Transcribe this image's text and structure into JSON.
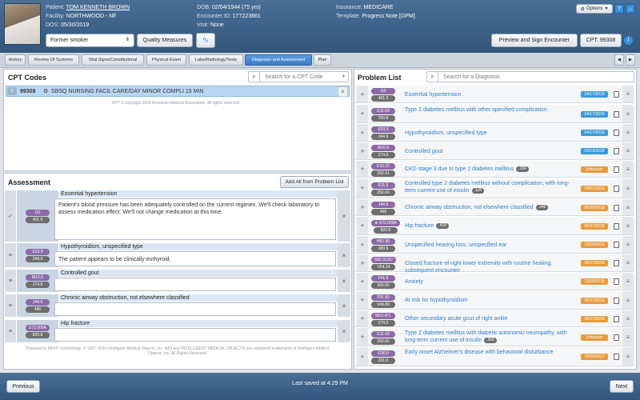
{
  "patient": {
    "label_patient": "Patient:",
    "name": "TOM KENNETH BROWN",
    "label_facility": "Facility:",
    "facility": "NORTHWOOD - NF",
    "label_dos": "DOS:",
    "dos": "05/30/2019",
    "label_dob": "DOB:",
    "dob": "02/04/1944 (75 yrs)",
    "label_encounter": "Encounter ID:",
    "encounter_id": "177223661",
    "label_visit": "Visit:",
    "visit": "None",
    "label_insurance": "Insurance:",
    "insurance": "MEDICARE",
    "label_template": "Template:",
    "template": "Progress Note [GPM]"
  },
  "header": {
    "options": "Options",
    "smoker": "Former smoker",
    "quality": "Quality Measures",
    "preview": "Preview and Sign Encounter",
    "cpt": "CPT: 99308"
  },
  "tabs": [
    "History",
    "Review Of Systems",
    "Vital Signs/Constitutional",
    "Physical Exam",
    "Labs/Radiology/Tests",
    "Diagnosis and Assessment",
    "Plan"
  ],
  "cpt": {
    "title": "CPT Codes",
    "search_placeholder": "Search for a CPT Code",
    "row_code": "99308",
    "row_desc": "SBSQ NURSING FACIL CARE/DAY MINOR COMPLI 15 MIN",
    "copyright": "CPT © copyright 2018 American Medical Association. All rights reserved."
  },
  "assessment": {
    "title": "Assessment",
    "add_all": "Add All from Problem List",
    "footer": "Powered by IMO® Terminology. © 1997–2015 Intelligent Medical Objects, Inc. IMO and INTELLIGENT MEDICAL OBJECTS are registered trademarks of Intelligent Medical Objects, Inc. All Rights Reserved.",
    "items": [
      {
        "c1": "I10",
        "c2": "401.9",
        "title": "Essential hypertension",
        "note": "Patient's blood pressure has been adequately controlled on the current regimen. We'll check laboratory to assess medication effect. We'll not change medication at this time."
      },
      {
        "c1": "E03.9",
        "c2": "244.9",
        "title": "Hypothyroidism, unspecified type",
        "note": "The patient appears to be clinically euthyroid."
      },
      {
        "c1": "M10.9",
        "c2": "274.9",
        "title": "Controlled gout",
        "note": ""
      },
      {
        "c1": "J44.9",
        "c2": "496",
        "title": "Chronic airway obstruction, not elsewhere classified",
        "note": ""
      },
      {
        "c1": "S72.009A",
        "c2": "820.8",
        "title": "Hip fracture",
        "note": ""
      }
    ]
  },
  "problems": {
    "title": "Problem List",
    "search_placeholder": "Search for a Diagnosis",
    "items": [
      {
        "c1": "I10",
        "c2": "401.9",
        "name": "Essential hypertension",
        "date": "04/17/2019",
        "pct": ""
      },
      {
        "c1": "E11.69",
        "c2": "250.8",
        "name": "Type 2 diabetes mellitus with other specified complication",
        "date": "04/17/2019",
        "pct": ""
      },
      {
        "c1": "E03.9",
        "c2": "244.9",
        "name": "Hypothyroidism, unspecified type",
        "date": "04/17/2019",
        "pct": ""
      },
      {
        "c1": "M10.9",
        "c2": "274.9",
        "name": "Controlled gout",
        "date": "02/19/2019",
        "pct": ""
      },
      {
        "c1": "E10.22",
        "c2": "250.41",
        "name": "CKD stage 3 due to type 1 diabetes mellitus",
        "date": "Unknown",
        "pct": ".266"
      },
      {
        "c1": "E11.9",
        "c2": "250.00",
        "name": "Controlled type 2 diabetes mellitus without complication, with long-term current use of insulin",
        "date": "09/01/2018",
        "pct": ".118"
      },
      {
        "c1": "J44.9",
        "c2": "496",
        "name": "Chronic airway obstruction, not elsewhere classified",
        "date": "09/30/2018",
        "pct": ".346"
      },
      {
        "c1": "★ S72.009A",
        "c2": "820.8",
        "name": "Hip fracture",
        "date": "06/27/2018",
        "pct": ".418"
      },
      {
        "c1": "H91.90",
        "c2": "389.9",
        "name": "Unspecified hearing loss, unspecified ear",
        "date": "12/18/2018",
        "pct": ""
      },
      {
        "c1": "S82.91XD",
        "c2": "V54.14",
        "name": "Closed fracture of right lower extremity with routine healing, subsequent encounter",
        "date": "06/27/2018",
        "pct": ""
      },
      {
        "c1": "F41.9",
        "c2": "300.00",
        "name": "Anxiety",
        "date": "12/18/2018",
        "pct": ""
      },
      {
        "c1": "Z91.89",
        "c2": "V49.89",
        "name": "At risk for hypothyroidism",
        "date": "06/27/2018",
        "pct": ""
      },
      {
        "c1": "M10.471",
        "c2": "274.9",
        "name": "Other secondary acute gout of right ankle",
        "date": "06/27/2018",
        "pct": ""
      },
      {
        "c1": "E11.43",
        "c2": "250.60",
        "name": "Type 2 diabetes mellitus with diabetic autonomic neuropathy, with long-term current use of insulin",
        "date": "Unknown",
        "pct": ".368"
      },
      {
        "c1": "G30.0",
        "c2": "331.0",
        "name": "Early onset Alzheimer's disease with behavioral disturbance",
        "date": "10/06/2017",
        "pct": ""
      }
    ]
  },
  "footer": {
    "previous": "Previous",
    "saved": "Last saved at 4:29 PM",
    "next": "Next"
  },
  "colors": {
    "date_blue": "#3a9ad9",
    "date_orange": "#e89b3c"
  }
}
